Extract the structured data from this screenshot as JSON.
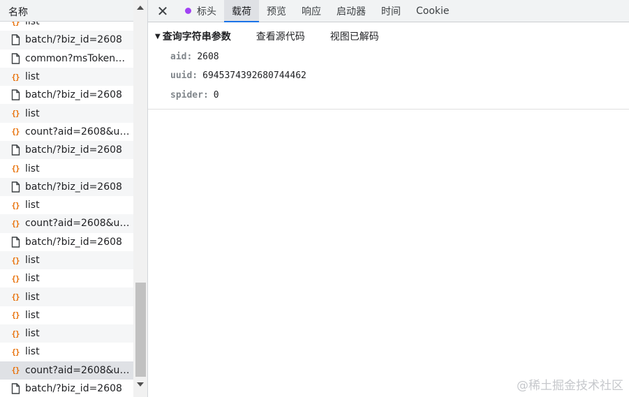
{
  "list": {
    "header": "名称",
    "rows": [
      {
        "type": "js",
        "label": "list"
      },
      {
        "type": "doc",
        "label": "batch/?biz_id=2608"
      },
      {
        "type": "doc",
        "label": "common?msToken=..."
      },
      {
        "type": "js",
        "label": "list"
      },
      {
        "type": "doc",
        "label": "batch/?biz_id=2608"
      },
      {
        "type": "js",
        "label": "list"
      },
      {
        "type": "js",
        "label": "count?aid=2608&uui..."
      },
      {
        "type": "doc",
        "label": "batch/?biz_id=2608"
      },
      {
        "type": "js",
        "label": "list"
      },
      {
        "type": "doc",
        "label": "batch/?biz_id=2608"
      },
      {
        "type": "js",
        "label": "list"
      },
      {
        "type": "js",
        "label": "count?aid=2608&uui..."
      },
      {
        "type": "doc",
        "label": "batch/?biz_id=2608"
      },
      {
        "type": "js",
        "label": "list"
      },
      {
        "type": "js",
        "label": "list"
      },
      {
        "type": "js",
        "label": "list"
      },
      {
        "type": "js",
        "label": "list"
      },
      {
        "type": "js",
        "label": "list"
      },
      {
        "type": "js",
        "label": "list"
      },
      {
        "type": "js",
        "label": "count?aid=2608&uui...",
        "selected": true
      },
      {
        "type": "doc",
        "label": "batch/?biz_id=2608"
      }
    ],
    "icons": {
      "js": "{}",
      "doc": "document-icon"
    }
  },
  "tabs": {
    "close": "✕",
    "items": [
      "标头",
      "载荷",
      "预览",
      "响应",
      "启动器",
      "时间",
      "Cookie"
    ],
    "active_index": 1
  },
  "payload": {
    "toggle": "▼",
    "title": "查询字符串参数",
    "view_source": "查看源代码",
    "view_decoded": "视图已解码",
    "params": [
      {
        "key": "aid:",
        "value": "2608"
      },
      {
        "key": "uuid:",
        "value": "6945374392680744462"
      },
      {
        "key": "spider:",
        "value": "0"
      }
    ]
  },
  "watermark": "@稀土掘金技术社区",
  "colors": {
    "accent": "#1a73e8",
    "js_icon": "#e8710a",
    "headers_dot": "#a142f4"
  }
}
